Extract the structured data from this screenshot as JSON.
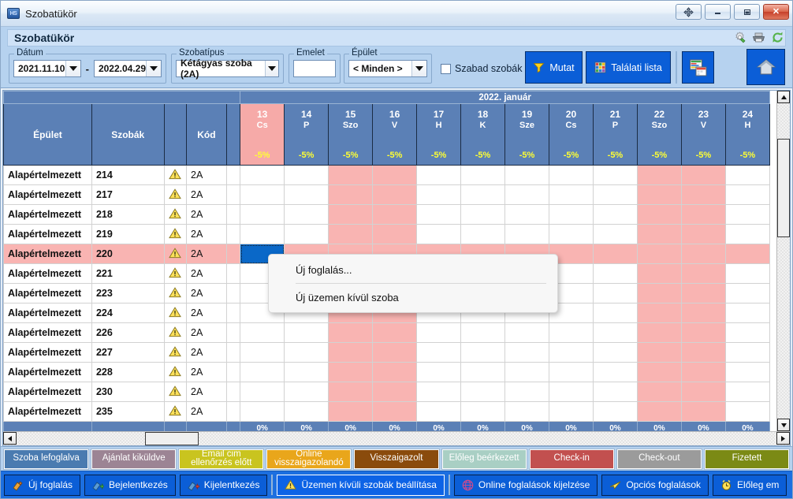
{
  "window": {
    "title": "Szobatükör",
    "app_icon": "HS",
    "controls": [
      {
        "name": "move-window-button",
        "glyph": "move"
      },
      {
        "name": "minimize-button",
        "glyph": "minimize"
      },
      {
        "name": "maximize-button",
        "glyph": "maximize"
      },
      {
        "name": "close-button",
        "glyph": "close"
      }
    ]
  },
  "header": {
    "page_title": "Szobatükör",
    "icons": [
      "settings-gear-icon",
      "printer-icon",
      "refresh-icon"
    ]
  },
  "toolbar": {
    "date_group_label": "Dátum",
    "date_from": "2021.11.10",
    "date_separator": "-",
    "date_to": "2022.04.29",
    "roomtype_group_label": "Szobatípus",
    "roomtype_value": "Kétágyas szoba (2A)",
    "floor_group_label": "Emelet",
    "floor_value": "",
    "building_group_label": "Épület",
    "building_value": "< Minden >",
    "free_rooms_label": "Szabad szobák",
    "free_rooms_checked": false,
    "show_button": "Mutat",
    "results_button": "Találati lista",
    "calendar_report_button": "",
    "home_button": ""
  },
  "grid": {
    "month_label": "2022. január",
    "columns": [
      "Épület",
      "Szobák",
      "",
      "Kód"
    ],
    "days": [
      {
        "num": "13",
        "weekday": "Cs",
        "pct": "-5%",
        "today": true,
        "weekend": false
      },
      {
        "num": "14",
        "weekday": "P",
        "pct": "-5%",
        "today": false,
        "weekend": false
      },
      {
        "num": "15",
        "weekday": "Szo",
        "pct": "-5%",
        "today": false,
        "weekend": true
      },
      {
        "num": "16",
        "weekday": "V",
        "pct": "-5%",
        "today": false,
        "weekend": true
      },
      {
        "num": "17",
        "weekday": "H",
        "pct": "-5%",
        "today": false,
        "weekend": false
      },
      {
        "num": "18",
        "weekday": "K",
        "pct": "-5%",
        "today": false,
        "weekend": false
      },
      {
        "num": "19",
        "weekday": "Sze",
        "pct": "-5%",
        "today": false,
        "weekend": false
      },
      {
        "num": "20",
        "weekday": "Cs",
        "pct": "-5%",
        "today": false,
        "weekend": false
      },
      {
        "num": "21",
        "weekday": "P",
        "pct": "-5%",
        "today": false,
        "weekend": false
      },
      {
        "num": "22",
        "weekday": "Szo",
        "pct": "-5%",
        "today": false,
        "weekend": true
      },
      {
        "num": "23",
        "weekday": "V",
        "pct": "-5%",
        "today": false,
        "weekend": true
      },
      {
        "num": "24",
        "weekday": "H",
        "pct": "-5%",
        "today": false,
        "weekend": false
      }
    ],
    "footer_values": [
      "0%",
      "0%",
      "0%",
      "0%",
      "0%",
      "0%",
      "0%",
      "0%",
      "0%",
      "0%",
      "0%",
      "0%"
    ],
    "rows": [
      {
        "building": "Alapértelmezett",
        "room": "214",
        "status_icon": "warning-icon",
        "code": "2A",
        "selected": false
      },
      {
        "building": "Alapértelmezett",
        "room": "217",
        "status_icon": "warning-icon",
        "code": "2A",
        "selected": false
      },
      {
        "building": "Alapértelmezett",
        "room": "218",
        "status_icon": "warning-icon",
        "code": "2A",
        "selected": false
      },
      {
        "building": "Alapértelmezett",
        "room": "219",
        "status_icon": "warning-icon",
        "code": "2A",
        "selected": false
      },
      {
        "building": "Alapértelmezett",
        "room": "220",
        "status_icon": "warning-icon",
        "code": "2A",
        "selected": true
      },
      {
        "building": "Alapértelmezett",
        "room": "221",
        "status_icon": "warning-icon",
        "code": "2A",
        "selected": false
      },
      {
        "building": "Alapértelmezett",
        "room": "223",
        "status_icon": "warning-icon",
        "code": "2A",
        "selected": false
      },
      {
        "building": "Alapértelmezett",
        "room": "224",
        "status_icon": "warning-icon",
        "code": "2A",
        "selected": false
      },
      {
        "building": "Alapértelmezett",
        "room": "226",
        "status_icon": "warning-icon",
        "code": "2A",
        "selected": false
      },
      {
        "building": "Alapértelmezett",
        "room": "227",
        "status_icon": "warning-icon",
        "code": "2A",
        "selected": false
      },
      {
        "building": "Alapértelmezett",
        "room": "228",
        "status_icon": "warning-icon",
        "code": "2A",
        "selected": false
      },
      {
        "building": "Alapértelmezett",
        "room": "230",
        "status_icon": "warning-icon",
        "code": "2A",
        "selected": false
      },
      {
        "building": "Alapértelmezett",
        "room": "235",
        "status_icon": "warning-icon",
        "code": "2A",
        "selected": false
      }
    ],
    "selected_cell": {
      "row_index": 4,
      "day_index": 0
    }
  },
  "context_menu": {
    "items": [
      {
        "label": "Új foglalás...",
        "name": "ctx-new-booking"
      },
      {
        "label": "Új üzemen kívül szoba",
        "name": "ctx-new-out-of-order-room"
      }
    ]
  },
  "legend": [
    {
      "label": "Szoba lefoglalva",
      "color": "#4a7bb0"
    },
    {
      "label": "Ajánlat kiküldve",
      "color": "#9c8494"
    },
    {
      "label": "Email cim ellenőrzés előtt",
      "color": "#c9c41f"
    },
    {
      "label": "Online visszaigazolandó",
      "color": "#e9a61b"
    },
    {
      "label": "Visszaigazolt",
      "color": "#8a4b0c"
    },
    {
      "label": "Előleg beérkezett",
      "color": "#a9cfc4"
    },
    {
      "label": "Check-in",
      "color": "#c2504f"
    },
    {
      "label": "Check-out",
      "color": "#9b9b9b"
    },
    {
      "label": "Fizetett",
      "color": "#7b8a15"
    }
  ],
  "actions": [
    {
      "label": "Új foglalás",
      "icon": "new-booking-icon",
      "highlight": false
    },
    {
      "label": "Bejelentkezés",
      "icon": "check-in-icon",
      "highlight": false
    },
    {
      "label": "Kijelentkezés",
      "icon": "check-out-icon",
      "highlight": false
    },
    {
      "label": "Üzemen kívüli szobák beállítása",
      "icon": "warning-icon",
      "highlight": true
    },
    {
      "label": "Online foglalások kijelzése",
      "icon": "globe-icon",
      "highlight": false
    },
    {
      "label": "Opciós foglalások",
      "icon": "paperplane-icon",
      "highlight": false
    },
    {
      "label": "Előleg em",
      "icon": "alarm-icon",
      "highlight": false
    }
  ],
  "colors": {
    "accent": "#0b5ed7",
    "header_blue": "#5b80b6",
    "panel_blue": "#b6d2ef",
    "weekend_pink": "#f9b4b2",
    "selection_blue": "#0a68c8",
    "discount_yellow": "#ffff33"
  }
}
